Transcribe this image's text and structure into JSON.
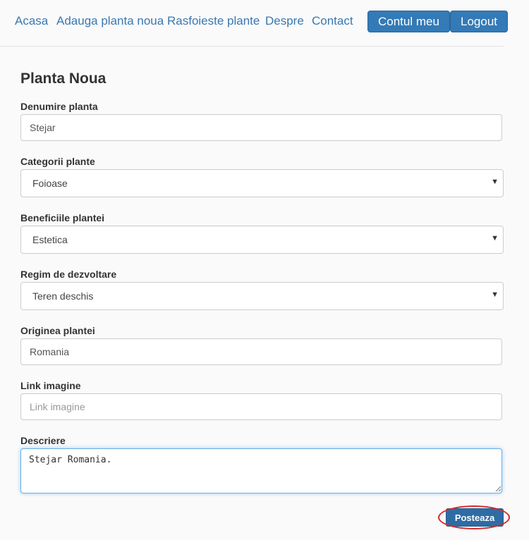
{
  "nav": {
    "links": [
      "Acasa",
      "Adauga planta noua",
      "Rasfoieste plante",
      "Despre",
      "Contact"
    ],
    "account_button": "Contul meu",
    "logout_button": "Logout"
  },
  "form": {
    "title": "Planta Noua",
    "name": {
      "label": "Denumire planta",
      "value": "Stejar"
    },
    "category": {
      "label": "Categorii plante",
      "value": "Foioase"
    },
    "benefits": {
      "label": "Beneficiile plantei",
      "value": "Estetica"
    },
    "growth": {
      "label": "Regim de dezvoltare",
      "value": "Teren deschis"
    },
    "origin": {
      "label": "Originea plantei",
      "value": "Romania"
    },
    "image_link": {
      "label": "Link imagine",
      "value": "",
      "placeholder": "Link imagine"
    },
    "description": {
      "label": "Descriere",
      "value": "Stejar Romania."
    },
    "submit_label": "Posteaza"
  },
  "icons": {
    "dropdown": "caret-down-icon",
    "resize": "resize-grip-icon"
  },
  "colors": {
    "primary": "#337ab7",
    "link": "#3a78b0",
    "highlight": "#d42a2a"
  }
}
